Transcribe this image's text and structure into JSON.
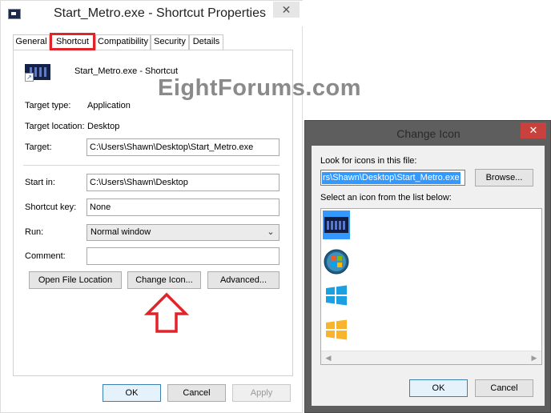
{
  "watermark": "EightForums.com",
  "properties": {
    "title": "Start_Metro.exe - Shortcut Properties",
    "close_glyph": "✕",
    "tabs": [
      {
        "label": "General",
        "active": false
      },
      {
        "label": "Shortcut",
        "active": true
      },
      {
        "label": "Compatibility",
        "active": false
      },
      {
        "label": "Security",
        "active": false
      },
      {
        "label": "Details",
        "active": false
      }
    ],
    "shortcut_name": "Start_Metro.exe - Shortcut",
    "target_type": {
      "label": "Target type:",
      "value": "Application"
    },
    "target_location": {
      "label": "Target location:",
      "value": "Desktop"
    },
    "target": {
      "label": "Target:",
      "value": "C:\\Users\\Shawn\\Desktop\\Start_Metro.exe"
    },
    "start_in": {
      "label": "Start in:",
      "value": "C:\\Users\\Shawn\\Desktop"
    },
    "shortcut_key": {
      "label": "Shortcut key:",
      "value": "None"
    },
    "run": {
      "label": "Run:",
      "value": "Normal window"
    },
    "comment": {
      "label": "Comment:",
      "value": ""
    },
    "buttons": {
      "open_file_location": "Open File Location",
      "change_icon": "Change Icon...",
      "advanced": "Advanced...",
      "ok": "OK",
      "cancel": "Cancel",
      "apply": "Apply"
    },
    "highlight_color": "#e0242a"
  },
  "change_icon": {
    "title": "Change Icon",
    "close_glyph": "✕",
    "look_label": "Look for icons in this file:",
    "path_value": "rs\\Shawn\\Desktop\\Start_Metro.exe",
    "browse": "Browse...",
    "select_label": "Select an icon from the list below:",
    "icons": [
      "metro-start-icon",
      "windows7-orb-icon",
      "windows8-logo-blue-icon",
      "windows8-logo-orange-icon"
    ],
    "selected_index": 0,
    "ok": "OK",
    "cancel": "Cancel"
  }
}
